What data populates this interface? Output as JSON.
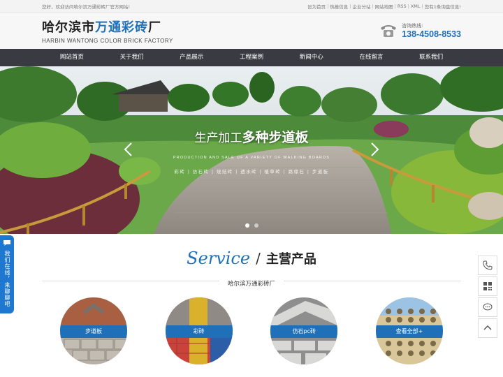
{
  "topbar": {
    "welcome": "您好，欢迎访问哈尔滨万通彩砖厂官方网站!",
    "links": [
      "设为首页",
      "热推信息",
      "企业分站",
      "网站地图",
      "RSS",
      "XML",
      "您有1条询盘信息!"
    ]
  },
  "header": {
    "logo_cn_prefix": "哈尔滨市",
    "logo_cn_highlight": "万通彩砖",
    "logo_cn_suffix": "厂",
    "logo_en": "HARBIN WANTONG COLOR BRICK FACTORY",
    "hotline_label": "咨询热线:",
    "hotline_number": "138-4508-8533"
  },
  "nav": {
    "items": [
      "网站首页",
      "关于我们",
      "产品展示",
      "工程案例",
      "新闻中心",
      "在线留言",
      "联系我们"
    ]
  },
  "banner": {
    "title_light": "生产加工",
    "title_bold": "多种步道板",
    "subtitle": "PRODUCTION AND SALE OF A VARIETY OF WALKING BOARDS",
    "tags": "彩砖 | 仿石砖 | 烧结砖 | 透水砖 | 植草砖 | 路缘石 | 步道板",
    "slide_count": 2,
    "active_slide": 1
  },
  "service": {
    "title_en": "Service",
    "slash": "/",
    "title_cn": "主营产品",
    "subtitle": "哈尔滨万通彩砖厂"
  },
  "products": [
    {
      "label": "步道板"
    },
    {
      "label": "彩砖"
    },
    {
      "label": "仿石pc砖"
    },
    {
      "label": "查看全部+"
    }
  ],
  "float_left": {
    "text": "我们在线，来聊聊吧"
  },
  "colors": {
    "brand_blue": "#1f70b8",
    "nav_bg": "#3a3a42"
  },
  "icons": {
    "phone": "phone-icon",
    "qrcode": "qrcode-icon",
    "chat": "chat-icon",
    "up": "arrow-up-icon"
  }
}
